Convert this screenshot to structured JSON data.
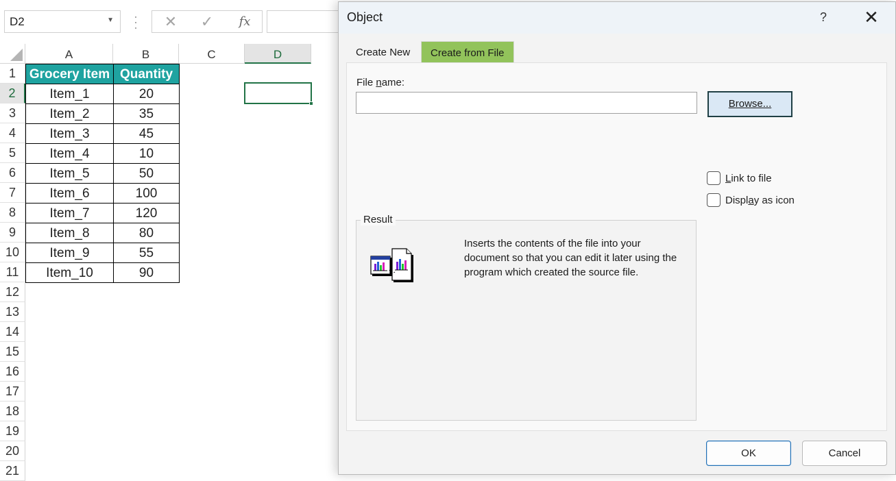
{
  "excel": {
    "name_box": "D2",
    "formula_buttons": {
      "cancel": "✕",
      "enter": "✓",
      "fx": "fx"
    },
    "columns": [
      "A",
      "B",
      "C",
      "D"
    ],
    "rows": [
      "1",
      "2",
      "3",
      "4",
      "5",
      "6",
      "7",
      "8",
      "9",
      "10",
      "11",
      "12",
      "13",
      "14",
      "15",
      "16",
      "17",
      "18",
      "19",
      "20",
      "21"
    ],
    "table": {
      "headers": [
        "Grocery Item",
        "Quantity"
      ],
      "rows": [
        [
          "Item_1",
          "20"
        ],
        [
          "Item_2",
          "35"
        ],
        [
          "Item_3",
          "45"
        ],
        [
          "Item_4",
          "10"
        ],
        [
          "Item_5",
          "50"
        ],
        [
          "Item_6",
          "100"
        ],
        [
          "Item_7",
          "120"
        ],
        [
          "Item_8",
          "80"
        ],
        [
          "Item_9",
          "55"
        ],
        [
          "Item_10",
          "90"
        ]
      ]
    },
    "header_fill_color": "#1fa3a0",
    "selection_color": "#217346"
  },
  "dialog": {
    "title": "Object",
    "help": "?",
    "close": "✕",
    "tabs": [
      "Create New",
      "Create from File"
    ],
    "active_tab_color": "#92c35b",
    "file_name_label_pre": "File ",
    "file_name_label_u": "n",
    "file_name_label_post": "ame:",
    "file_name_value": "",
    "browse_label": "Browse...",
    "link_to_file_u": "L",
    "link_to_file_post": "ink to file",
    "display_as_icon_pre": "Displ",
    "display_as_icon_u": "a",
    "display_as_icon_post": "y as icon",
    "result_label": "Result",
    "result_text": "Inserts the contents of the file into your document so that you can edit it later using the program which created the source file.",
    "ok_label": "OK",
    "cancel_label": "Cancel"
  }
}
